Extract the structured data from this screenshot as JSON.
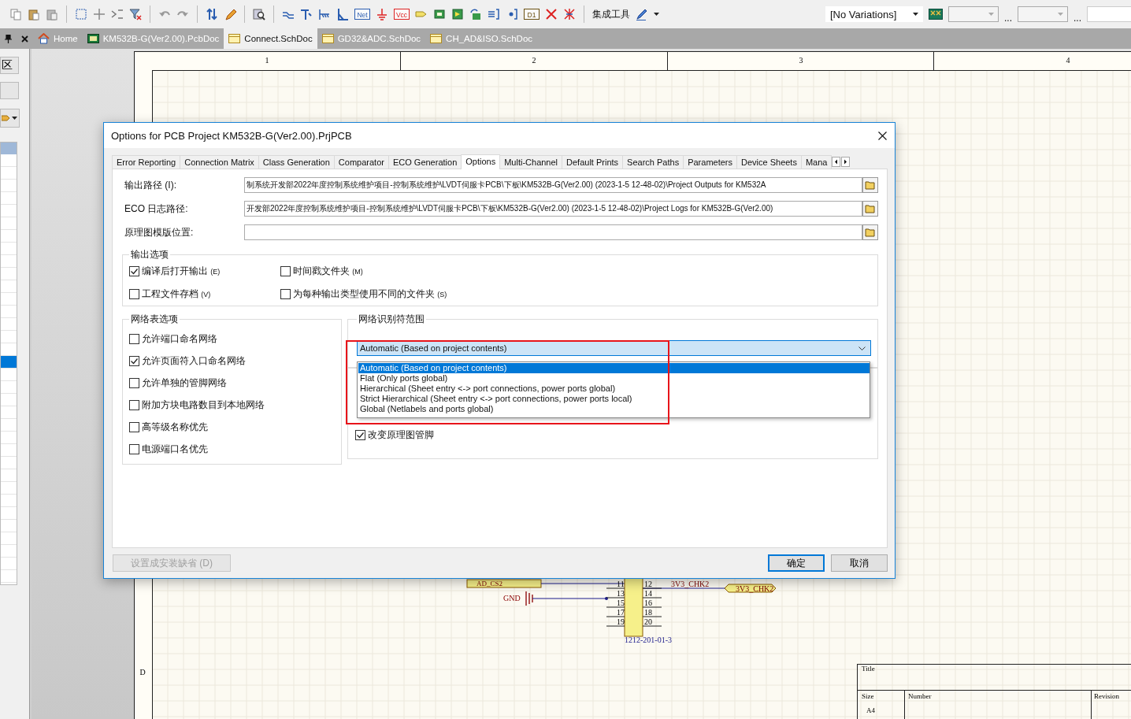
{
  "toolbar": {
    "icon_labels": [
      "Net",
      "Vcc",
      "D1"
    ],
    "tool_label": "集成工具",
    "variant_combo": "[No Variations]",
    "more_buttons": [
      "...",
      "..."
    ]
  },
  "document_tabs": [
    {
      "label": "Home",
      "kind": "home",
      "selected": false
    },
    {
      "label": "KM532B-G(Ver2.00).PcbDoc",
      "kind": "pcb",
      "selected": false
    },
    {
      "label": "Connect.SchDoc",
      "kind": "sch",
      "selected": true
    },
    {
      "label": "GD32&ADC.SchDoc",
      "kind": "sch",
      "selected": false
    },
    {
      "label": "CH_AD&ISO.SchDoc",
      "kind": "sch",
      "selected": false
    }
  ],
  "side_panel": {
    "buttons": [
      "区"
    ],
    "rows": [
      {
        "selected": false
      },
      {
        "selected": false
      },
      {
        "selected": false
      },
      {
        "selected": false
      },
      {
        "selected": false
      },
      {
        "selected": false
      },
      {
        "selected": false
      },
      {
        "selected": false
      },
      {
        "selected": false
      },
      {
        "selected": false
      },
      {
        "selected": false
      },
      {
        "selected": false
      },
      {
        "selected": false
      },
      {
        "selected": false
      },
      {
        "selected": false
      },
      {
        "selected": false
      },
      {
        "selected": true
      },
      {
        "selected": false
      },
      {
        "selected": false
      },
      {
        "selected": false
      },
      {
        "selected": false
      },
      {
        "selected": false
      },
      {
        "selected": false
      },
      {
        "selected": false
      },
      {
        "selected": false
      },
      {
        "selected": false
      },
      {
        "selected": false
      },
      {
        "selected": false
      },
      {
        "selected": false
      },
      {
        "selected": false
      },
      {
        "selected": false
      },
      {
        "selected": false
      },
      {
        "selected": false
      },
      {
        "selected": false
      }
    ]
  },
  "sheet": {
    "column_labels": [
      "1",
      "2",
      "3",
      "4"
    ],
    "row_label": "D",
    "schematic": {
      "port_label": "AD_CS2",
      "net_label": "3V3_CHK2",
      "ports": [
        "3V3_CHK2"
      ],
      "ground_label": "GND",
      "pins": [
        [
          "11",
          "12"
        ],
        [
          "13",
          "14"
        ],
        [
          "15",
          "16"
        ],
        [
          "17",
          "18"
        ],
        [
          "19",
          "20"
        ]
      ],
      "part_ref": "1212-201-01-3"
    },
    "title_block": {
      "title_label": "Title",
      "size_label": "Size",
      "size_value": "A4",
      "number_label": "Number",
      "revision_label": "Revision"
    }
  },
  "dialog": {
    "title": "Options for PCB Project KM532B-G(Ver2.00).PrjPCB",
    "tabs": [
      {
        "label": "Error Reporting",
        "selected": false
      },
      {
        "label": "Connection Matrix",
        "selected": false
      },
      {
        "label": "Class Generation",
        "selected": false
      },
      {
        "label": "Comparator",
        "selected": false
      },
      {
        "label": "ECO Generation",
        "selected": false
      },
      {
        "label": "Options",
        "selected": true
      },
      {
        "label": "Multi-Channel",
        "selected": false
      },
      {
        "label": "Default Prints",
        "selected": false
      },
      {
        "label": "Search Paths",
        "selected": false
      },
      {
        "label": "Parameters",
        "selected": false
      },
      {
        "label": "Device Sheets",
        "selected": false
      },
      {
        "label": "Mana",
        "selected": false
      }
    ],
    "paths": [
      {
        "label": "输出路径 (I):",
        "value": "制系统开发部2022年度控制系统维护项目-控制系统维护\\LVDT伺服卡PCB\\下板\\KM532B-G(Ver2.00) (2023-1-5 12-48-02)\\Project Outputs for KM532A"
      },
      {
        "label": "ECO 日志路径:",
        "value": "开发部2022年度控制系统维护项目-控制系统维护\\LVDT伺服卡PCB\\下板\\KM532B-G(Ver2.00) (2023-1-5 12-48-02)\\Project Logs for KM532B-G(Ver2.00)"
      },
      {
        "label": "原理图模版位置:"
      }
    ],
    "output_options": {
      "title": "输出选项",
      "items": [
        {
          "label": "编译后打开输出",
          "shortcut": "(E)",
          "checked": true
        },
        {
          "label": "时间戳文件夹",
          "shortcut": "(M)",
          "checked": false
        },
        {
          "label": "工程文件存档",
          "shortcut": "(V)",
          "checked": false
        },
        {
          "label": "为每种输出类型使用不同的文件夹",
          "shortcut": "(S)",
          "checked": false
        }
      ]
    },
    "netlist_options": {
      "title": "网络表选项",
      "items": [
        {
          "label": "允许端口命名网络",
          "checked": false
        },
        {
          "label": "允许页面符入口命名网络",
          "checked": true
        },
        {
          "label": "允许单独的管脚网络",
          "checked": false
        },
        {
          "label": "附加方块电路数目到本地网络",
          "checked": false
        },
        {
          "label": "高等级名称优先",
          "checked": false
        },
        {
          "label": "电源端口名优先",
          "checked": false
        }
      ]
    },
    "net_scope": {
      "title": "网络识别符范围",
      "value": "Automatic (Based on project contents)",
      "options": [
        {
          "label": "Automatic (Based on project contents)",
          "selected": true
        },
        {
          "label": "Flat (Only ports global)",
          "selected": false
        },
        {
          "label": "Hierarchical (Sheet entry <-> port connections, power ports global)",
          "selected": false
        },
        {
          "label": "Strict Hierarchical (Sheet entry <-> port connections, power ports local)",
          "selected": false
        },
        {
          "label": "Global (Netlabels and ports global)",
          "selected": false
        }
      ]
    },
    "pin_option": {
      "label": "改变原理图管脚",
      "checked": true
    },
    "buttons": [
      {
        "label": "设置成安装缺省 (D)",
        "kind": "default",
        "disabled": true
      },
      {
        "label": "确定",
        "kind": "ok",
        "disabled": false
      },
      {
        "label": "取消",
        "kind": "cancel",
        "disabled": false
      }
    ]
  }
}
